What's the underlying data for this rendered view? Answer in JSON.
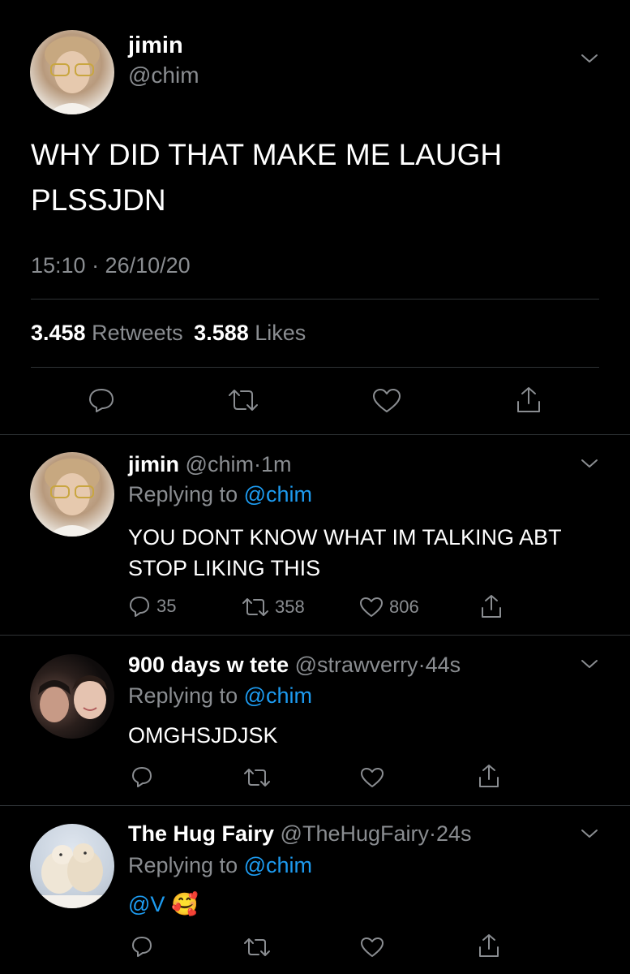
{
  "main_tweet": {
    "display_name": "jimin",
    "handle": "@chim",
    "text_line1": "WHY DID THAT MAKE ME LAUGH",
    "text_line2": "PLSSJDN",
    "timestamp": "15:10 · 26/10/20",
    "retweets_count": "3.458",
    "retweets_label": "Retweets",
    "likes_count": "3.588",
    "likes_label": "Likes"
  },
  "replies": [
    {
      "display_name": "jimin",
      "handle": "@chim",
      "time": "1m",
      "replying_prefix": "Replying to",
      "replying_to": "@chim",
      "text_line1": "YOU DONT KNOW WHAT IM TALKING ABT",
      "text_line2": "STOP LIKING THIS",
      "reply_count": "35",
      "retweet_count": "358",
      "like_count": "806"
    },
    {
      "display_name": "900 days w tete",
      "handle": "@strawverry",
      "time": "44s",
      "replying_prefix": "Replying to",
      "replying_to": "@chim",
      "text_line1": "OMGHSJDJSK"
    },
    {
      "display_name": "The Hug Fairy",
      "handle": "@TheHugFairy",
      "time": "24s",
      "replying_prefix": "Replying to",
      "replying_to": "@chim",
      "mention": "@V",
      "emoji": "🥰"
    }
  ],
  "separator": "·",
  "icons": {
    "reply": "reply-icon",
    "retweet": "retweet-icon",
    "like": "heart-icon",
    "share": "share-icon",
    "more": "chevron-down-icon"
  },
  "colors": {
    "background": "#000000",
    "link": "#1d9bf0",
    "muted": "#8a8d91",
    "divider": "#2f3336"
  }
}
